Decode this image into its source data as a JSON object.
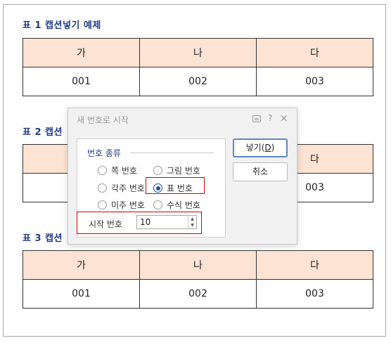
{
  "captions": [
    "표 1 캡션넣기 예제",
    "표 2 캡션",
    "표 3 캡션"
  ],
  "table1": {
    "header": [
      "가",
      "나",
      "다"
    ],
    "row": [
      "001",
      "002",
      "003"
    ]
  },
  "table2": {
    "header": [
      "다"
    ],
    "row": [
      "003"
    ]
  },
  "table3": {
    "header": [
      "가",
      "나",
      "다"
    ],
    "row": [
      "001",
      "002",
      "003"
    ]
  },
  "dialog": {
    "title": "새 번호로 시작",
    "help_label": "?",
    "close_label": "×",
    "group_title": "번호 종류",
    "options": [
      "쪽 번호",
      "그림 번호",
      "각주 번호",
      "표 번호",
      "미주 번호",
      "수식 번호"
    ],
    "selected_option": "표 번호",
    "start_label": "시작 번호",
    "start_value": "10",
    "insert_label": "넣기(",
    "insert_hotkey": "D",
    "insert_close": ")",
    "cancel_label": "취소"
  },
  "colors": {
    "caption": "#1f3b87",
    "table_header_bg": "#fde3d3",
    "highlight_border": "#d40000",
    "primary_border": "#5a86c7"
  }
}
